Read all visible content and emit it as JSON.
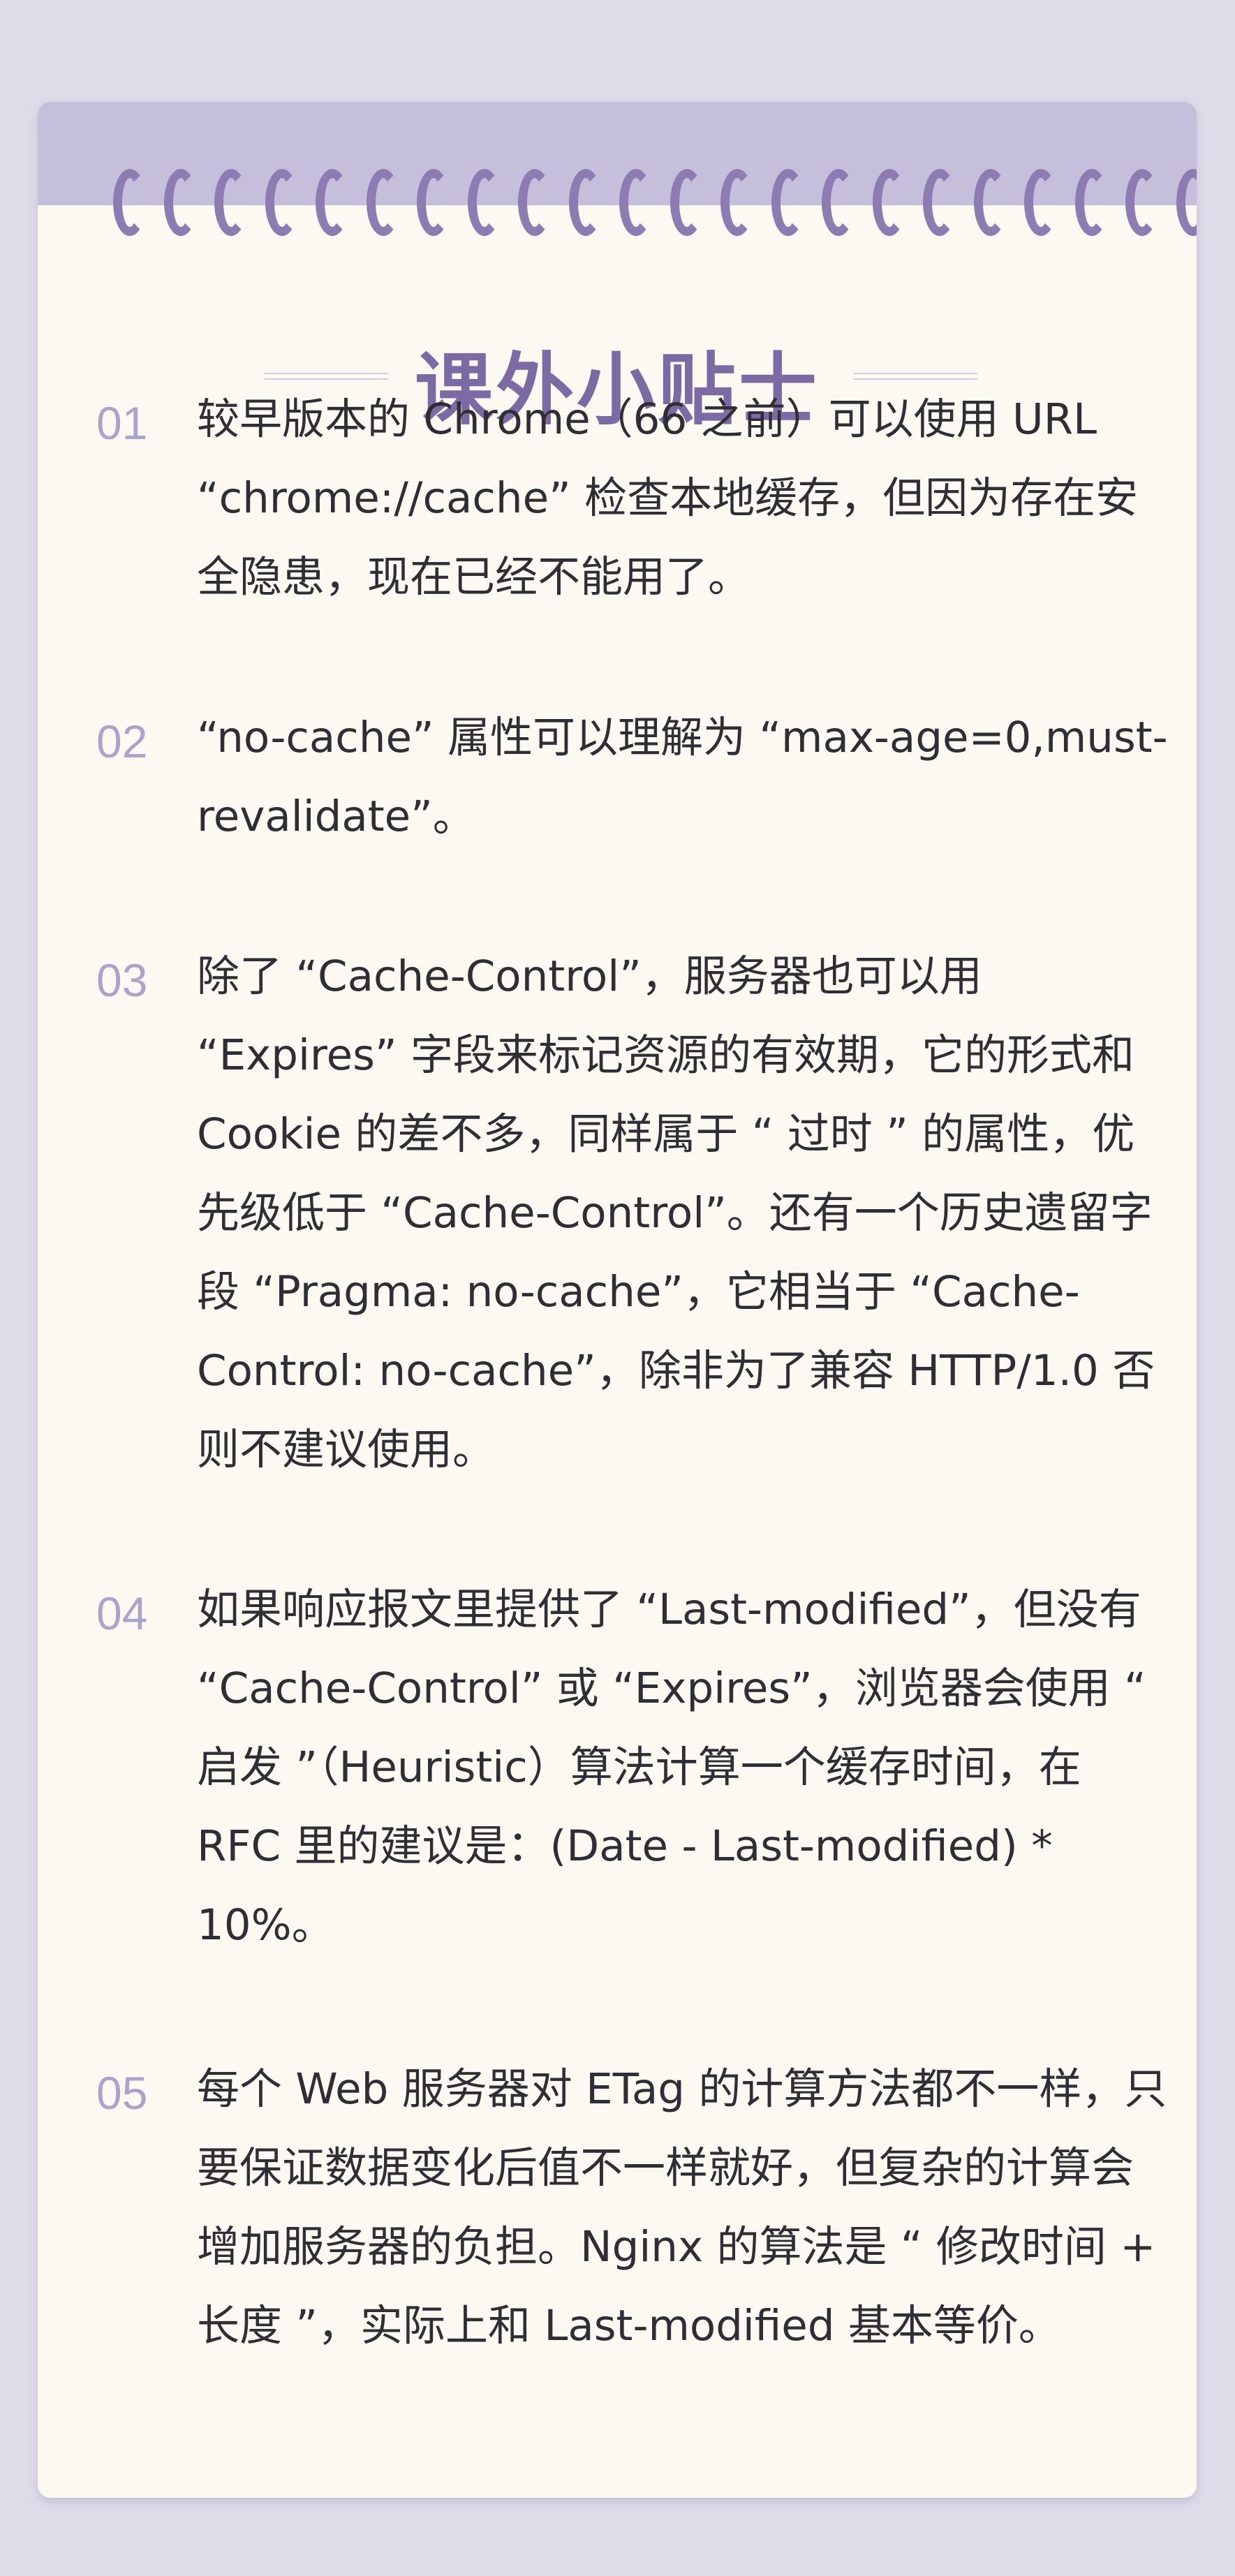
{
  "title": "课外小贴士",
  "tips": [
    {
      "number": "01",
      "text": "较早版本的 Chrome（66 之前）可以使用 URL “chrome://cache” 检查本地缓存，但因为存在安全隐患，现在已经不能用了。"
    },
    {
      "number": "02",
      "text": "“no-cache” 属性可以理解为 “max-age=0,must-revalidate”。"
    },
    {
      "number": "03",
      "text": "除了 “Cache-Control”，服务器也可以用 “Expires” 字段来标记资源的有效期，它的形式和 Cookie 的差不多，同样属于 “ 过时 ” 的属性，优先级低于 “Cache-Control”。还有一个历史遗留字段 “Pragma: no-cache”，它相当于 “Cache-Control: no-cache”，除非为了兼容 HTTP/1.0 否则不建议使用。"
    },
    {
      "number": "04",
      "text": "如果响应报文里提供了 “Last-modified”，但没有 “Cache-Control” 或 “Expires”，浏览器会使用 “ 启发 ”（Heuristic）算法计算一个缓存时间，在 RFC 里的建议是：(Date - Last-modified) * 10%。"
    },
    {
      "number": "05",
      "text": "每个 Web 服务器对 ETag 的计算方法都不一样，只要保证数据变化后值不一样就好，但复杂的计算会增加服务器的负担。Nginx 的算法是 “ 修改时间 + 长度 ”，实际上和 Last-modified 基本等价。"
    }
  ]
}
